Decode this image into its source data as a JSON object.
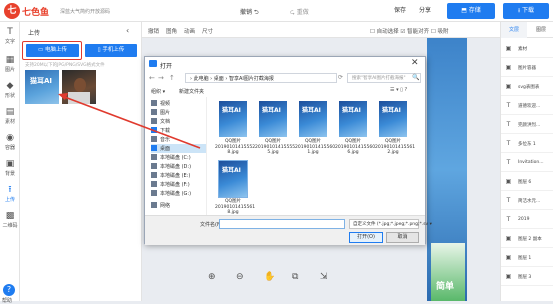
{
  "topbar": {
    "logo_char": "七",
    "logo_text": "七色鱼",
    "tagline": "深蓝大气简约开放源码",
    "undo": "撤销 ⮌",
    "redo": "⮎ 重做",
    "save": "保存",
    "share": "分享",
    "save_primary": "⬒ 存储",
    "download": "⭳ 下载"
  },
  "leftbar": {
    "items": [
      {
        "icon": "T",
        "label": "文字"
      },
      {
        "icon": "▦",
        "label": "图片"
      },
      {
        "icon": "◆",
        "label": "形状"
      },
      {
        "icon": "▤",
        "label": "素材"
      },
      {
        "icon": "◉",
        "label": "容器"
      },
      {
        "icon": "▣",
        "label": "背景"
      },
      {
        "icon": "⭱",
        "label": "上传"
      },
      {
        "icon": "▩",
        "label": "二维码"
      }
    ],
    "help": "?",
    "help_label": "帮助"
  },
  "panel": {
    "title": "上传",
    "collapse": "‹",
    "btn_pc": "▭ 电脑上传",
    "btn_phone": "▯ 手机上传",
    "support_text": "支持20M以下的JPG/PNG/SVG格式文件",
    "thumb1_text": "猫耳AI"
  },
  "canvas": {
    "tools": [
      "撤销",
      "图角",
      "动画",
      "尺寸"
    ],
    "autoalign": "☐ 自动选择  ☑ 智能对齐  ☐ 吸附",
    "green_text": "简单",
    "zoom": [
      "⊕",
      "⊖",
      "✋",
      "⧉",
      "⇲"
    ]
  },
  "rightpanel": {
    "tab1": "文层",
    "tab2": "图层",
    "items": [
      {
        "icon": "▣",
        "label": "素材"
      },
      {
        "icon": "▣",
        "label": "图片容器"
      },
      {
        "icon": "▣",
        "label": "svg表图表"
      },
      {
        "icon": "T",
        "label": "道德欢迎..."
      },
      {
        "icon": "T",
        "label": "完颜洪烈..."
      },
      {
        "icon": "T",
        "label": "多位东 1"
      },
      {
        "icon": "T",
        "label": "Invitation..."
      },
      {
        "icon": "▣",
        "label": "图层 6"
      },
      {
        "icon": "T",
        "label": "简洁水元..."
      },
      {
        "icon": "T",
        "label": "2019"
      },
      {
        "icon": "▣",
        "label": "图层 2 副本"
      },
      {
        "icon": "▣",
        "label": "图层 1"
      },
      {
        "icon": "▣",
        "label": "图层 3"
      }
    ]
  },
  "dialog": {
    "title": "打开",
    "close": "✕",
    "nav": [
      "←",
      "→",
      "↑",
      "⟳"
    ],
    "crumb": "›  此电脑  ›  桌面  ›  智享AI图片打截海报",
    "search_placeholder": "搜索\"智享AI图片打截海报\"",
    "search_icon": "🔍",
    "cmd_organize": "组织 ▾",
    "cmd_newfolder": "新建文件夹",
    "view_mode": "☰ ▾  ▯  ?",
    "tree": [
      {
        "label": "视频",
        "color": "#6b7a8f"
      },
      {
        "label": "图片",
        "color": "#6b7a8f"
      },
      {
        "label": "文档",
        "color": "#6b7a8f"
      },
      {
        "label": "下载",
        "color": "#1f7cf0"
      },
      {
        "label": "音乐",
        "color": "#6b7a8f"
      },
      {
        "label": "桌面",
        "color": "#1f7cf0"
      },
      {
        "label": "本地磁盘 (C:)",
        "color": "#6b7a8f"
      },
      {
        "label": "本地磁盘 (D:)",
        "color": "#6b7a8f"
      },
      {
        "label": "本地磁盘 (E:)",
        "color": "#6b7a8f"
      },
      {
        "label": "本地磁盘 (F:)",
        "color": "#6b7a8f"
      },
      {
        "label": "本地磁盘 (G:)",
        "color": "#6b7a8f"
      },
      {
        "label": "网络",
        "color": "#6b7a8f"
      }
    ],
    "files": [
      {
        "badge": "猫耳AI",
        "name": "QQ图片 20190101415552 8.jpg"
      },
      {
        "badge": "猫耳AI",
        "name": "QQ图片 20190101415555 5.jpg"
      },
      {
        "badge": "猫耳AI",
        "name": "QQ图片 20190101415560 1.jpg"
      },
      {
        "badge": "猫耳AI",
        "name": "QQ图片 20190101415560 6.jpg"
      },
      {
        "badge": "猫耳AI",
        "name": "QQ图片 20190101415561 2.jpg"
      },
      {
        "badge": "猫耳AI",
        "name": "QQ图片 20190101415561 8.jpg"
      }
    ],
    "filename_label": "文件名(N):",
    "filename_value": "",
    "filetype": "自定义文件 (*.jpg;*.jpeg;*.png;*.sv ▾",
    "btn_open": "打开(O)",
    "btn_cancel": "取消"
  }
}
